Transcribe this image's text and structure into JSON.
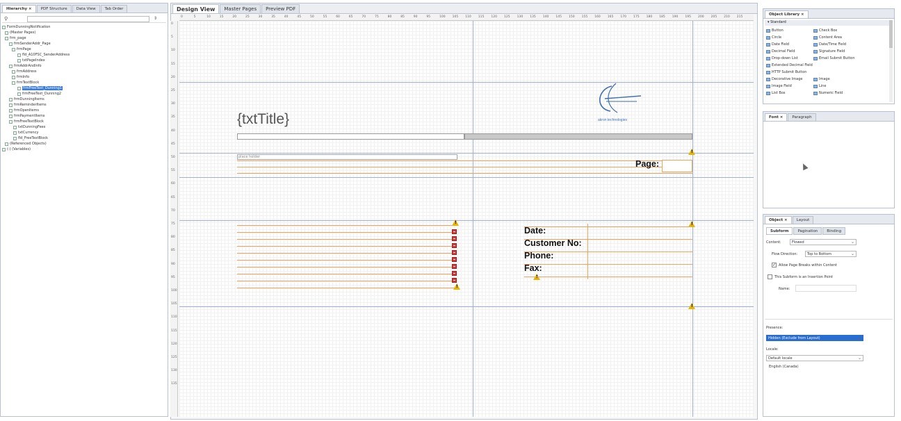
{
  "hierarchy": {
    "tabs": [
      "Hierarchy ×",
      "PDF Structure",
      "Data View",
      "Tab Order"
    ],
    "nodes": [
      {
        "label": "FormDunningNotification",
        "selected": false
      },
      {
        "label": "(Master Pages)",
        "selected": false
      },
      {
        "label": "frm_page",
        "selected": false
      },
      {
        "label": "frmSenderAddr_Page",
        "selected": false
      },
      {
        "label": "frmPage",
        "selected": false
      },
      {
        "label": "fld_A10FSC_SenderAddress",
        "selected": false
      },
      {
        "label": "txtPageIndex",
        "selected": false
      },
      {
        "label": "frmAddrAndInfo",
        "selected": false
      },
      {
        "label": "frmAddress",
        "selected": false
      },
      {
        "label": "frmInfo",
        "selected": false
      },
      {
        "label": "frmTextBlock",
        "selected": false
      },
      {
        "label": "frmFreeText_Dunning1",
        "selected": true
      },
      {
        "label": "frmFreeText_Dunning2",
        "selected": false
      },
      {
        "label": "frmDunningItems",
        "selected": false
      },
      {
        "label": "frmReminderItems",
        "selected": false
      },
      {
        "label": "frmOpenItems",
        "selected": false
      },
      {
        "label": "frmPaymentItems",
        "selected": false
      },
      {
        "label": "frmFreeTextBlock",
        "selected": false
      },
      {
        "label": "txtDunningFees",
        "selected": false
      },
      {
        "label": "txtCurrency",
        "selected": false
      },
      {
        "label": "fld_FreeTextBlock",
        "selected": false
      },
      {
        "label": "(Referenced Objects)",
        "selected": false
      },
      {
        "label": "(-) (Variables)",
        "selected": false
      }
    ]
  },
  "editor": {
    "tabs": [
      "Design View",
      "Master Pages",
      "Preview PDF"
    ],
    "ruler_top": [
      "0",
      "5",
      "10",
      "15",
      "20",
      "25",
      "30",
      "35",
      "40",
      "45",
      "50",
      "55",
      "60",
      "65",
      "70",
      "75",
      "80",
      "85",
      "90",
      "95",
      "100",
      "105",
      "110",
      "115",
      "120",
      "125",
      "130",
      "135",
      "140",
      "145",
      "150",
      "155",
      "160",
      "165",
      "170",
      "175",
      "180",
      "185",
      "190",
      "195",
      "200",
      "205",
      "210",
      "215"
    ],
    "ruler_left": [
      "0",
      "5",
      "10",
      "15",
      "20",
      "25",
      "30",
      "35",
      "40",
      "45",
      "50",
      "55",
      "60",
      "65",
      "70",
      "75",
      "80",
      "85",
      "90",
      "95",
      "100",
      "105",
      "110",
      "115",
      "120",
      "125",
      "130",
      "135"
    ],
    "title_placeholder": "{txtTitle}",
    "logo_text": "akron technologies",
    "place_holder_text": "place holder",
    "page_label": "Page:",
    "date_label": "Date:",
    "customer_label": "Customer No:",
    "phone_label": "Phone:",
    "fax_label": "Fax:"
  },
  "object_library": {
    "title": "Object Library ×",
    "section": "Standard",
    "items_left": [
      "Button",
      "Circle",
      "Date Field",
      "Decimal Field",
      "Drop-down List",
      "Extended Decimal Field",
      "HTTP Submit Button",
      "Decorative Image",
      "Image Field",
      "List Box"
    ],
    "items_right": [
      "Check Box",
      "Content Area",
      "Date/Time Field",
      "Signature Field",
      "Email Submit Button",
      "",
      "",
      "Image",
      "Line",
      "Numeric Field"
    ]
  },
  "font_panel": {
    "tabs": [
      "Font ×",
      "Paragraph"
    ]
  },
  "object_panel": {
    "tabs": [
      "Object ×",
      "Layout"
    ],
    "subtabs": [
      "Subform",
      "Pagination",
      "Binding"
    ],
    "content_label": "Content:",
    "content_value": "Flowed",
    "flow_label": "Flow Direction:",
    "flow_value": "Top to Bottom",
    "allow_breaks_label": "Allow Page Breaks within Content",
    "insertion_label": "This Subform is an Insertion Point",
    "name_label": "Name:",
    "presence_label": "Presence:",
    "presence_value": "Hidden (Exclude from Layout)",
    "locale_label": "Locale:",
    "locale_value": "Default locale",
    "locale_note": "English (Canada)"
  }
}
